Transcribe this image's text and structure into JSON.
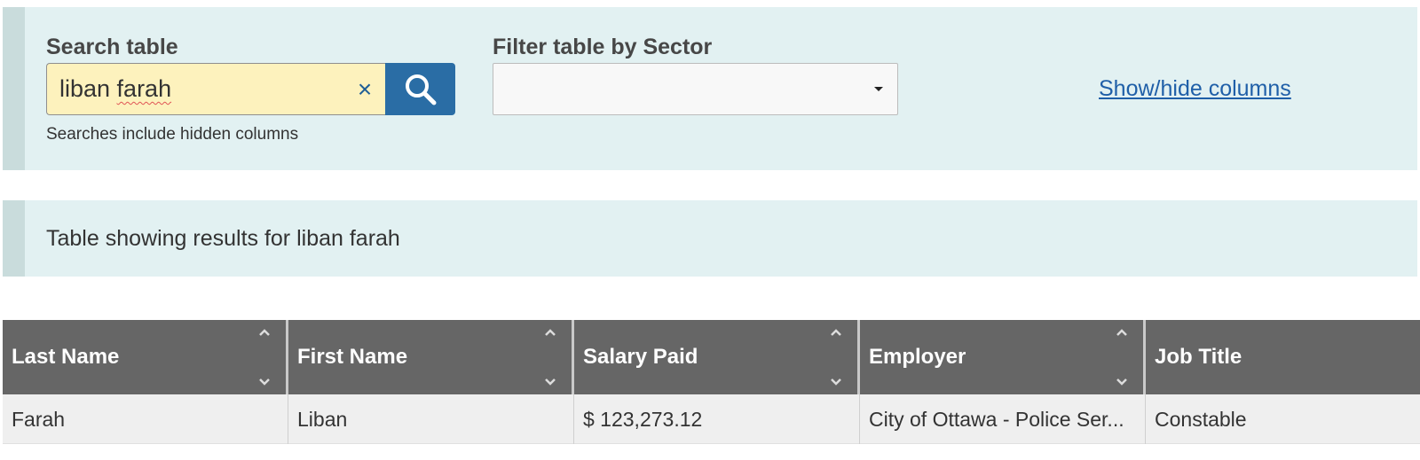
{
  "search": {
    "label": "Search table",
    "value_plain": "liban ",
    "value_flagged": "farah",
    "clear_symbol": "×",
    "hint": "Searches include hidden columns"
  },
  "filter": {
    "label": "Filter table by Sector",
    "selected": ""
  },
  "columns_toggle": "Show/hide columns",
  "results_caption": "Table showing results for liban farah",
  "table": {
    "headers": [
      "Last Name",
      "First Name",
      "Salary Paid",
      "Employer",
      "Job Title"
    ],
    "rows": [
      [
        "Farah",
        "Liban",
        "$ 123,273.12",
        "City of Ottawa - Police Ser...",
        "Constable"
      ]
    ]
  },
  "colors": {
    "panel_bg": "#e2f1f2",
    "search_button": "#2a6da5",
    "link": "#1f5fa8",
    "header_bg": "#666666"
  },
  "icons": {
    "search_button": "magnifier-icon",
    "clear": "close-icon",
    "select": "caret-down-icon",
    "sort": "sort-up-down-icons"
  }
}
